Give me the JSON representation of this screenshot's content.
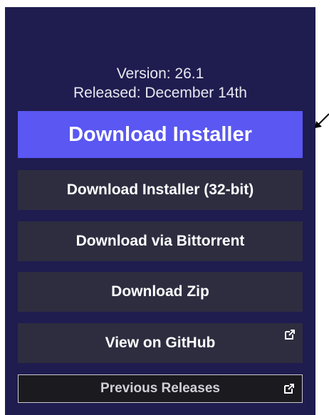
{
  "release": {
    "version_text": "Version: 26.1",
    "released_text": "Released: December 14th"
  },
  "buttons": {
    "primary_label": "Download Installer",
    "installer_32_label": "Download Installer (32-bit)",
    "bittorrent_label": "Download via Bittorrent",
    "zip_label": "Download Zip",
    "github_label": "View on GitHub",
    "previous_label": "Previous Releases"
  },
  "icons": {
    "external_link": "external-link-icon",
    "annotation_arrow": "arrow-icon"
  },
  "colors": {
    "panel_bg": "#1f1c4f",
    "primary_button": "#5a57f2",
    "secondary_button": "#2e2d40"
  }
}
